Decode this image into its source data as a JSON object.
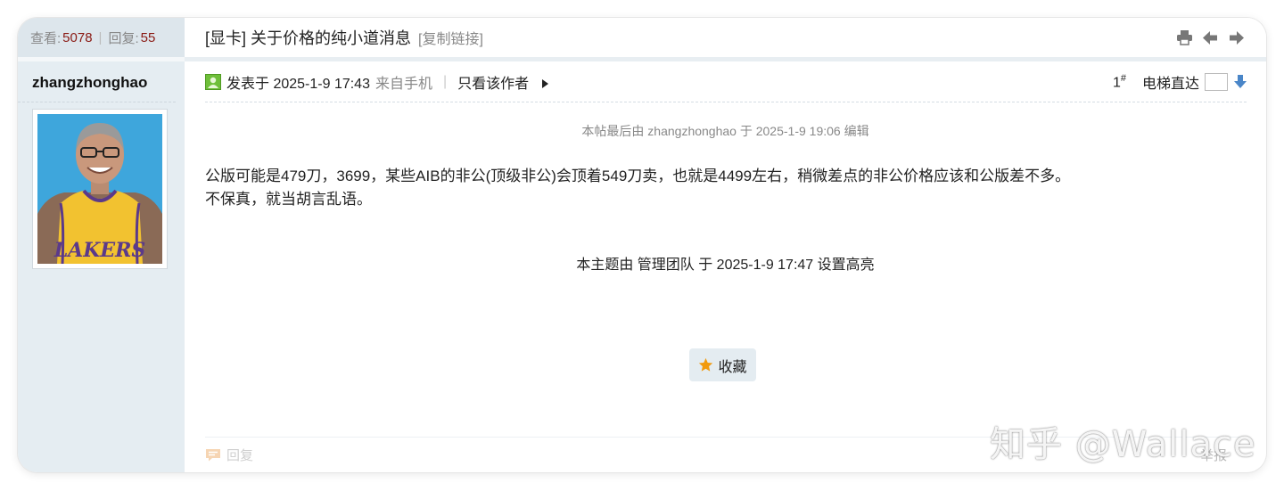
{
  "stats": {
    "views_label": "查看:",
    "views": "5078",
    "replies_label": "回复:",
    "replies": "55"
  },
  "thread": {
    "title": "[显卡] 关于价格的纯小道消息",
    "copy_link": "[复制链接]"
  },
  "author": {
    "name": "zhangzhonghao"
  },
  "post": {
    "posted_at": "发表于 2025-1-9 17:43",
    "from_mobile": "来自手机",
    "separator": "|",
    "only_author": "只看该作者",
    "floor": "1",
    "floor_mark": "#",
    "jump_label": "电梯直达",
    "edit_note": "本帖最后由 zhangzhonghao 于 2025-1-9 19:06 编辑",
    "body_line1": "公版可能是479刀，3699，某些AIB的非公(顶级非公)会顶着549刀卖，也就是4499左右，稍微差点的非公价格应该和公版差不多。",
    "body_line2": "不保真，就当胡言乱语。",
    "highlight_note": "本主题由 管理团队 于 2025-1-9 17:47 设置高亮",
    "favorite": "收藏",
    "reply": "回复",
    "report": "举报"
  },
  "watermark": "知乎 @Wallace",
  "colors": {
    "sidebar_bg": "#e5edf2",
    "stat_number": "#8a1a14",
    "favorite_bg": "#e4ecf1",
    "star": "#f19a0e",
    "jump_arrow": "#4a86c8"
  },
  "icons": [
    "print-icon",
    "prev-arrow-icon",
    "next-arrow-icon",
    "online-status-icon",
    "triangle-right-icon",
    "down-arrow-icon",
    "star-icon",
    "reply-icon"
  ]
}
